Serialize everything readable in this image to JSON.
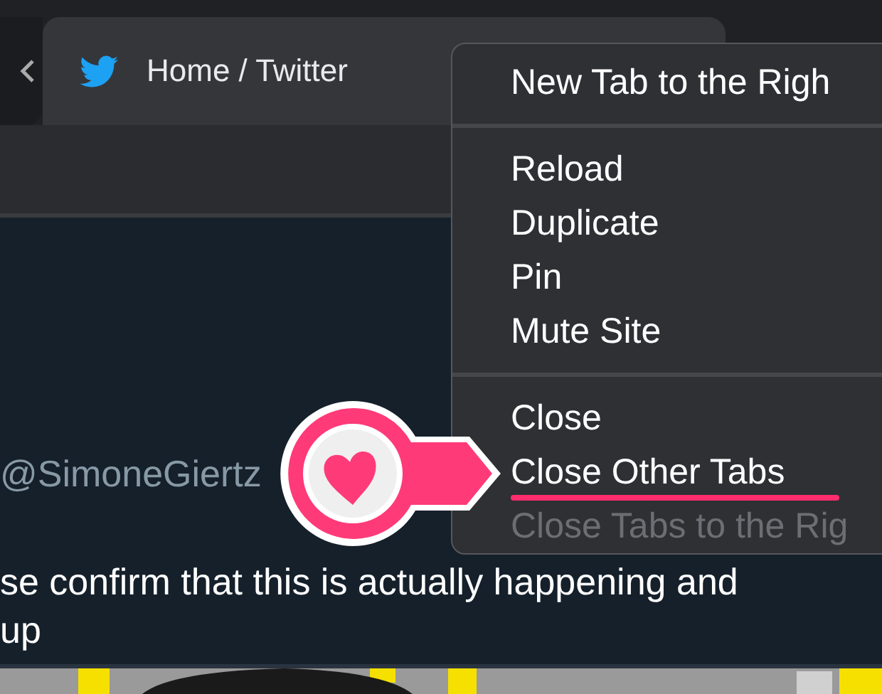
{
  "tab": {
    "title": "Home / Twitter",
    "selected": true
  },
  "tweet": {
    "handle": "@SimoneGiertz",
    "lines": [
      "se confirm that this is actually happening and",
      "up"
    ]
  },
  "menu": {
    "items": [
      {
        "kind": "item",
        "label": "New Tab to the Righ",
        "disabled": false,
        "highlighted": false
      },
      {
        "kind": "separator"
      },
      {
        "kind": "item",
        "label": "Reload",
        "disabled": false,
        "highlighted": false
      },
      {
        "kind": "item",
        "label": "Duplicate",
        "disabled": false,
        "highlighted": false
      },
      {
        "kind": "item",
        "label": "Pin",
        "disabled": false,
        "highlighted": false
      },
      {
        "kind": "item",
        "label": "Mute Site",
        "disabled": false,
        "highlighted": false
      },
      {
        "kind": "separator"
      },
      {
        "kind": "item",
        "label": "Close",
        "disabled": false,
        "highlighted": false
      },
      {
        "kind": "item",
        "label": "Close Other Tabs",
        "disabled": false,
        "highlighted": true
      },
      {
        "kind": "item",
        "label": "Close Tabs to the Rig",
        "disabled": true,
        "highlighted": false
      }
    ]
  }
}
